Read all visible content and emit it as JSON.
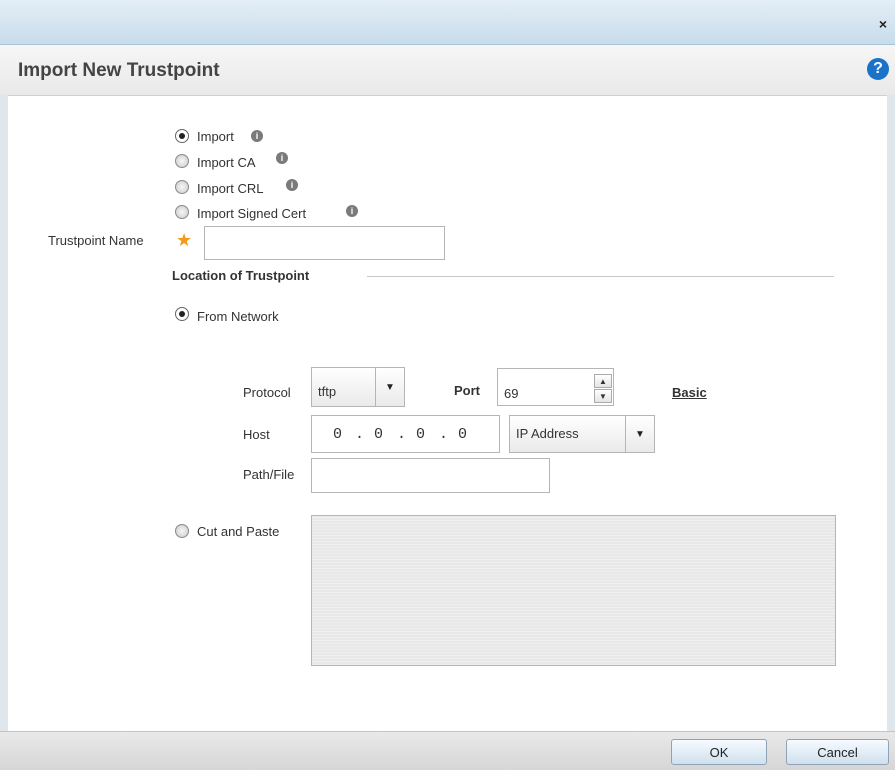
{
  "window": {
    "close_label": "×"
  },
  "header": {
    "title": "Import New Trustpoint",
    "help_label": "?"
  },
  "import_type": {
    "options": [
      {
        "label": "Import",
        "selected": true
      },
      {
        "label": "Import CA",
        "selected": false
      },
      {
        "label": "Import CRL",
        "selected": false
      },
      {
        "label": "Import Signed Cert",
        "selected": false
      }
    ],
    "info_glyph": "i"
  },
  "trustpoint_name": {
    "label": "Trustpoint Name",
    "required_mark": "★",
    "value": ""
  },
  "location": {
    "section_title": "Location of Trustpoint",
    "from_network_label": "From Network",
    "cut_and_paste_label": "Cut and Paste",
    "paste_value": ""
  },
  "network": {
    "protocol_label": "Protocol",
    "protocol_value": "tftp",
    "port_label": "Port",
    "port_value": "69",
    "basic_link": "Basic",
    "host_label": "Host",
    "host_octets": [
      "0",
      "0",
      "0",
      "0"
    ],
    "host_type_value": "IP Address",
    "path_label": "Path/File",
    "path_value": ""
  },
  "footer": {
    "ok_label": "OK",
    "cancel_label": "Cancel"
  },
  "colors": {
    "accent": "#1a73c8",
    "required": "#f29a1a"
  },
  "icons": {
    "close": "close-icon",
    "help": "help-icon",
    "info": "info-icon",
    "dropdown": "chevron-down-icon"
  }
}
